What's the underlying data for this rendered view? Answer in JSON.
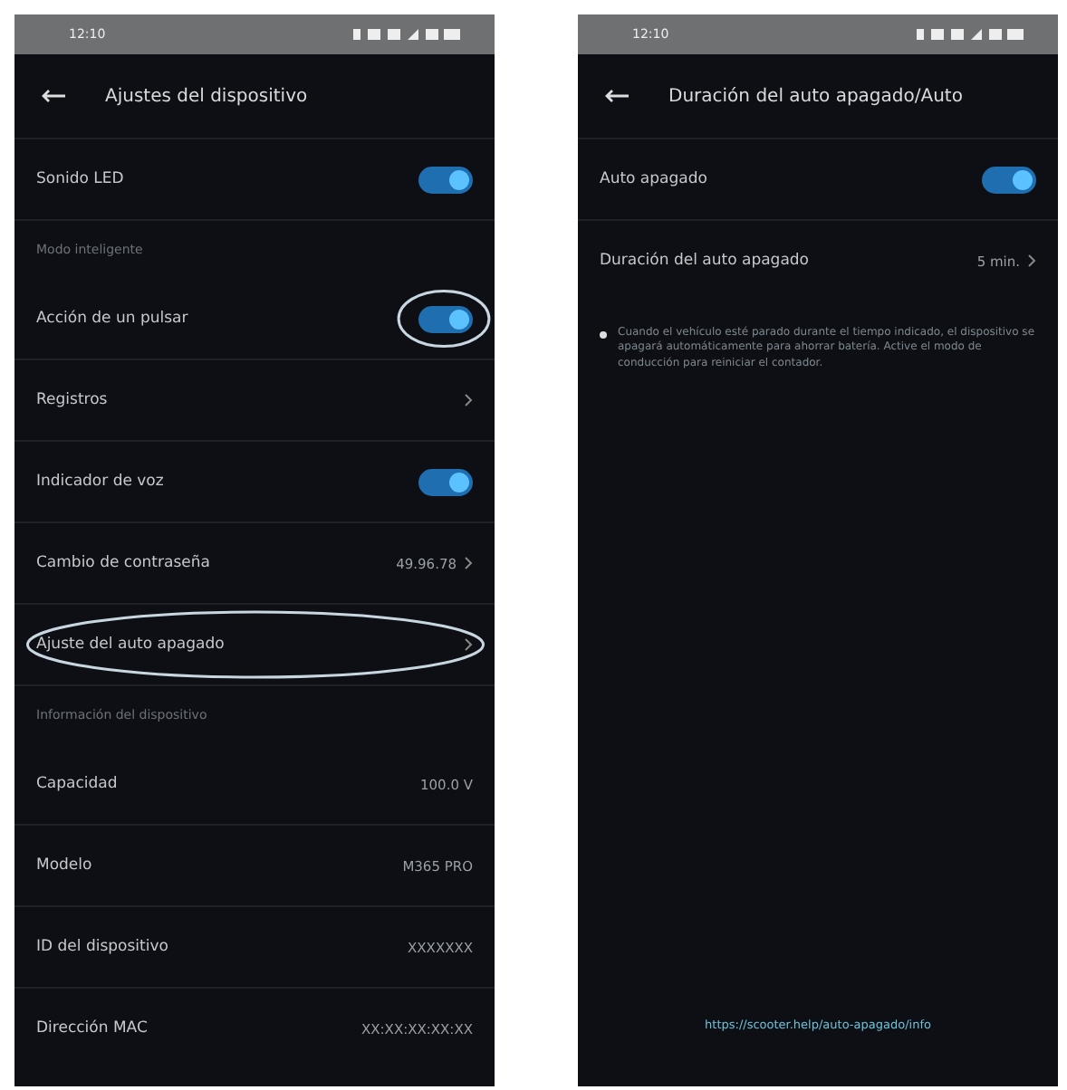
{
  "screens": [
    {
      "status_bar": {
        "time": "12:10"
      },
      "title": "Ajustes del dispositivo",
      "rows": [
        {
          "kind": "toggle",
          "label": "Sonido LED",
          "on": true,
          "circled": false
        },
        {
          "kind": "section",
          "label": "Modo inteligente"
        },
        {
          "kind": "toggle",
          "label": "Acción de un pulsar",
          "on": true,
          "circled": true
        },
        {
          "kind": "link",
          "label": "Registros",
          "circled": false
        },
        {
          "kind": "toggle",
          "label": "Indicador de voz",
          "on": true,
          "circled": false
        },
        {
          "kind": "link",
          "label": "Cambio de contraseña",
          "value": "49.96.78",
          "circled": false
        },
        {
          "kind": "link",
          "label": "Ajuste del auto apagado",
          "circled": true
        },
        {
          "kind": "section",
          "label": "Información del dispositivo"
        },
        {
          "kind": "info",
          "label": "Capacidad",
          "value": "100.0 V"
        },
        {
          "kind": "info",
          "label": "Modelo",
          "value": "M365 PRO"
        },
        {
          "kind": "info",
          "label": "ID del dispositivo",
          "value": "XXXXXXX"
        },
        {
          "kind": "info",
          "label": "Dirección MAC",
          "value": "XX:XX:XX:XX:XX"
        }
      ]
    },
    {
      "status_bar": {
        "time": "12:10"
      },
      "title": "Duración del auto apagado/Auto",
      "rows": [
        {
          "kind": "toggle",
          "label": "Auto apagado",
          "on": true,
          "circled": false
        },
        {
          "kind": "link",
          "label": "Duración del auto apagado",
          "value": "5 min.",
          "circled": false
        }
      ],
      "note": "Cuando el vehículo esté parado durante el tiempo indicado, el dispositivo se apagará automáticamente para ahorrar batería. Active el modo de conducción para reiniciar el contador.",
      "footer_link": "https://scooter.help/auto-apagado/info"
    }
  ]
}
